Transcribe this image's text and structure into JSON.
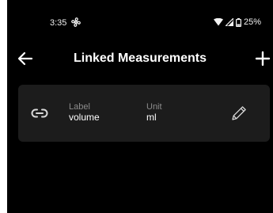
{
  "status_bar": {
    "time": "3:35",
    "battery": "25%"
  },
  "app_bar": {
    "title": "Linked Measurements"
  },
  "measurements": [
    {
      "label_caption": "Label",
      "label_value": "volume",
      "unit_caption": "Unit",
      "unit_value": "ml"
    }
  ],
  "icons": {
    "status": [
      "fan-icon",
      "wifi-icon",
      "signal-icon",
      "battery-icon"
    ],
    "app_bar": [
      "back-arrow-icon",
      "add-icon"
    ],
    "card": [
      "link-icon",
      "pencil-icon"
    ]
  },
  "colors": {
    "background": "#000000",
    "card": "#1c1c1c",
    "caption": "#8c8c8c",
    "text": "#ffffff"
  }
}
